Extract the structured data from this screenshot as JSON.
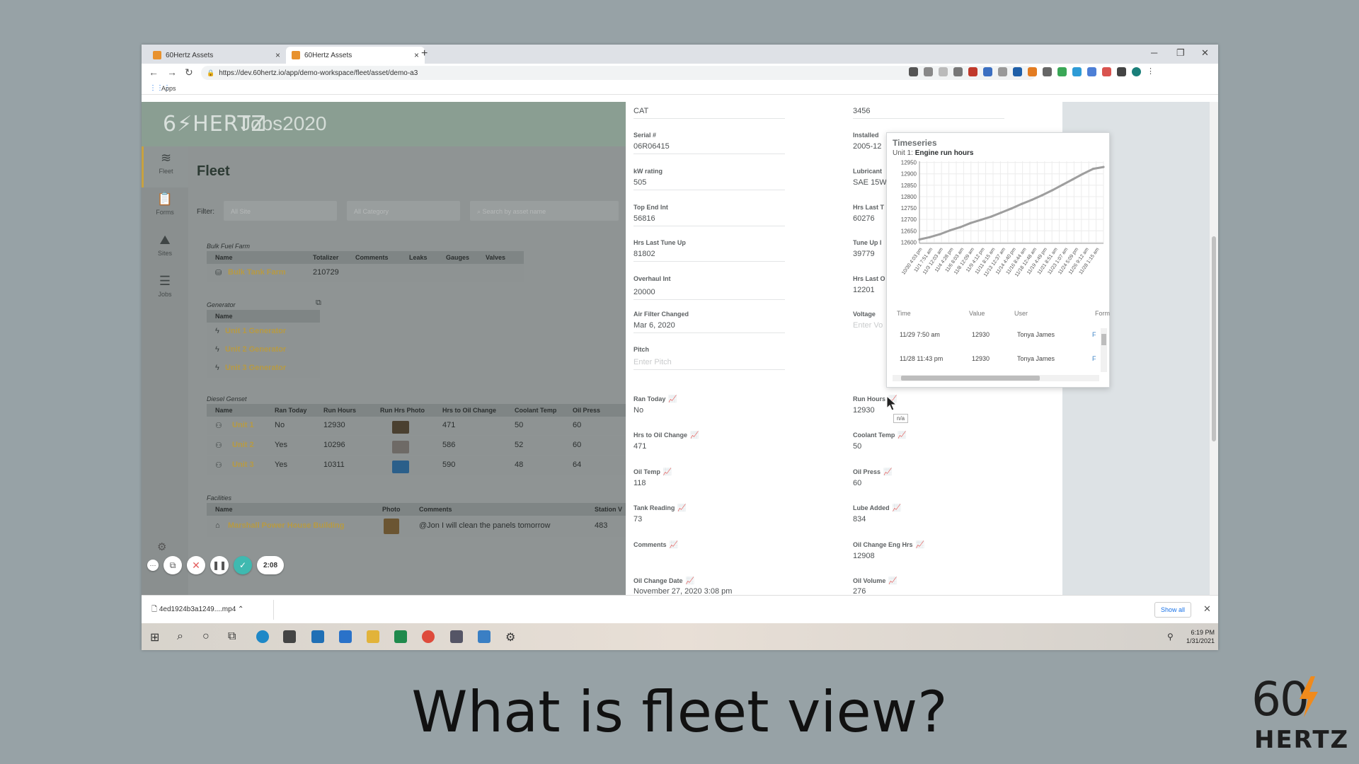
{
  "browser": {
    "tabs": [
      {
        "label": "60Hertz Assets",
        "active": false
      },
      {
        "label": "60Hertz Assets",
        "active": true
      }
    ],
    "url": "https://dev.60hertz.io/app/demo-workspace/fleet/asset/demo-a3",
    "bookmarks_label": "Apps"
  },
  "app": {
    "logo": "6⚡HERTZ",
    "workspace": "Jobs2020",
    "sidebar": [
      {
        "label": "Fleet",
        "icon": "layers-icon"
      },
      {
        "label": "Forms",
        "icon": "clipboard-icon"
      },
      {
        "label": "Sites",
        "icon": "map-icon"
      },
      {
        "label": "Jobs",
        "icon": "checklist-icon"
      }
    ],
    "page_title": "Fleet",
    "filter": {
      "label": "Filter:",
      "site_placeholder": "All Site",
      "category_placeholder": "All Category",
      "search_placeholder": "Search by asset name"
    },
    "bulk_fuel": {
      "title": "Bulk Fuel Farm",
      "columns": [
        "Name",
        "Totalizer",
        "Comments",
        "Leaks",
        "Gauges",
        "Valves"
      ],
      "rows": [
        {
          "name": "Bulk Tank Farm",
          "totalizer": "210729"
        }
      ]
    },
    "generator": {
      "title": "Generator",
      "columns": [
        "Name"
      ],
      "rows": [
        "Unit 1 Generator",
        "Unit 2 Generator",
        "Unit 3 Generator"
      ]
    },
    "diesel": {
      "title": "Diesel Genset",
      "columns": [
        "Name",
        "Ran Today",
        "Run Hours",
        "Run Hrs Photo",
        "Hrs to Oil Change",
        "Coolant Temp",
        "Oil Press"
      ],
      "rows": [
        {
          "name": "Unit 1",
          "ran": "No",
          "hours": "12930",
          "oil": "471",
          "coolant": "50",
          "press": "60"
        },
        {
          "name": "Unit 2",
          "ran": "Yes",
          "hours": "10296",
          "oil": "586",
          "coolant": "52",
          "press": "60"
        },
        {
          "name": "Unit 3",
          "ran": "Yes",
          "hours": "10311",
          "oil": "590",
          "coolant": "48",
          "press": "64"
        }
      ]
    },
    "facilities": {
      "title": "Facilities",
      "columns": [
        "Name",
        "Photo",
        "Comments",
        "Station V"
      ],
      "rows": [
        {
          "name": "Marshall Power House Building",
          "comment": "@Jon I will clean the panels tomorrow",
          "station": "483"
        }
      ]
    }
  },
  "detail": {
    "left": [
      {
        "label": "",
        "value": "CAT"
      },
      {
        "label": "Serial #",
        "value": "06R06415"
      },
      {
        "label": "kW rating",
        "value": "505"
      },
      {
        "label": "Top End Int",
        "value": "56816"
      },
      {
        "label": "Hrs Last Tune Up",
        "value": "81802"
      },
      {
        "label": "Overhaul Int",
        "value": "20000"
      },
      {
        "label": "Air Filter Changed",
        "value": "Mar 6, 2020"
      },
      {
        "label": "Pitch",
        "value": "Enter Pitch"
      }
    ],
    "right": [
      {
        "label": "",
        "value": "3456"
      },
      {
        "label": "Installed",
        "value": "2005-12"
      },
      {
        "label": "Lubricant",
        "value": "SAE 15W"
      },
      {
        "label": "Hrs Last T",
        "value": "60276"
      },
      {
        "label": "Tune Up I",
        "value": "39779"
      },
      {
        "label": "Hrs Last O",
        "value": "12201"
      },
      {
        "label": "Voltage",
        "value": "Enter Vo"
      }
    ],
    "readings_left": [
      {
        "label": "Ran Today",
        "value": "No"
      },
      {
        "label": "Hrs to Oil Change",
        "value": "471"
      },
      {
        "label": "Oil Temp",
        "value": "118"
      },
      {
        "label": "Tank Reading",
        "value": "73"
      },
      {
        "label": "Comments",
        "value": ""
      },
      {
        "label": "Oil Change Date",
        "value": "November 27, 2020 3:08 pm"
      }
    ],
    "readings_right": [
      {
        "label": "Run Hours",
        "value": "12930"
      },
      {
        "label": "Coolant Temp",
        "value": "50"
      },
      {
        "label": "Oil Press",
        "value": "60"
      },
      {
        "label": "Lube Added",
        "value": "834"
      },
      {
        "label": "Oil Change Eng Hrs",
        "value": "12908"
      },
      {
        "label": "Oil Volume",
        "value": "276"
      }
    ]
  },
  "timeseries": {
    "title": "Timeseries",
    "subtitle_prefix": "Unit 1:",
    "subtitle_metric": "Engine run hours",
    "table_columns": [
      "Time",
      "Value",
      "User",
      "Form"
    ],
    "table_rows": [
      {
        "time": "11/29 7:50 am",
        "value": "12930",
        "user": "Tonya James",
        "form": "F"
      },
      {
        "time": "11/28 11:43 pm",
        "value": "12930",
        "user": "Tonya James",
        "form": "F"
      }
    ],
    "tooltip": "n/a"
  },
  "chart_data": {
    "type": "line",
    "title": "",
    "xlabel": "",
    "ylabel": "",
    "ylim": [
      12595,
      12955
    ],
    "yticks": [
      12600,
      12650,
      12700,
      12750,
      12800,
      12850,
      12900,
      12950
    ],
    "grid": true,
    "x": [
      "10/30 4:03 pm",
      "11/1 7:51 am",
      "11/3 12:03 am",
      "11/4 4:28 pm",
      "11/6 8:03 am",
      "11/8 12:09 am",
      "11/9 4:12 pm",
      "11/11 8:15 am",
      "11/13 12:37 am",
      "11/14 4:40 pm",
      "11/16 8:44 am",
      "11/18 12:48 am",
      "11/19 4:49 pm",
      "11/21 8:51 am",
      "11/23 1:07 am",
      "11/24 5:09 pm",
      "11/26 9:12 am",
      "11/28 1:15 am"
    ],
    "series": [
      {
        "values": [
          12612,
          12622,
          12635,
          12652,
          12666,
          12684,
          12698,
          12712,
          12730,
          12748,
          12768,
          12786,
          12806,
          12828,
          12852,
          12876,
          12900,
          12922,
          12930
        ]
      }
    ],
    "color": "#9e9e9e"
  },
  "recorder": {
    "time": "2:08"
  },
  "download": {
    "file": "4ed1924b3a1249....mp4",
    "show_all": "Show all"
  },
  "taskbar": {
    "time": "6:19 PM",
    "date": "1/31/2021"
  },
  "caption": "What is fleet view?",
  "brand": {
    "num": "60",
    "word": "HERTZ"
  }
}
